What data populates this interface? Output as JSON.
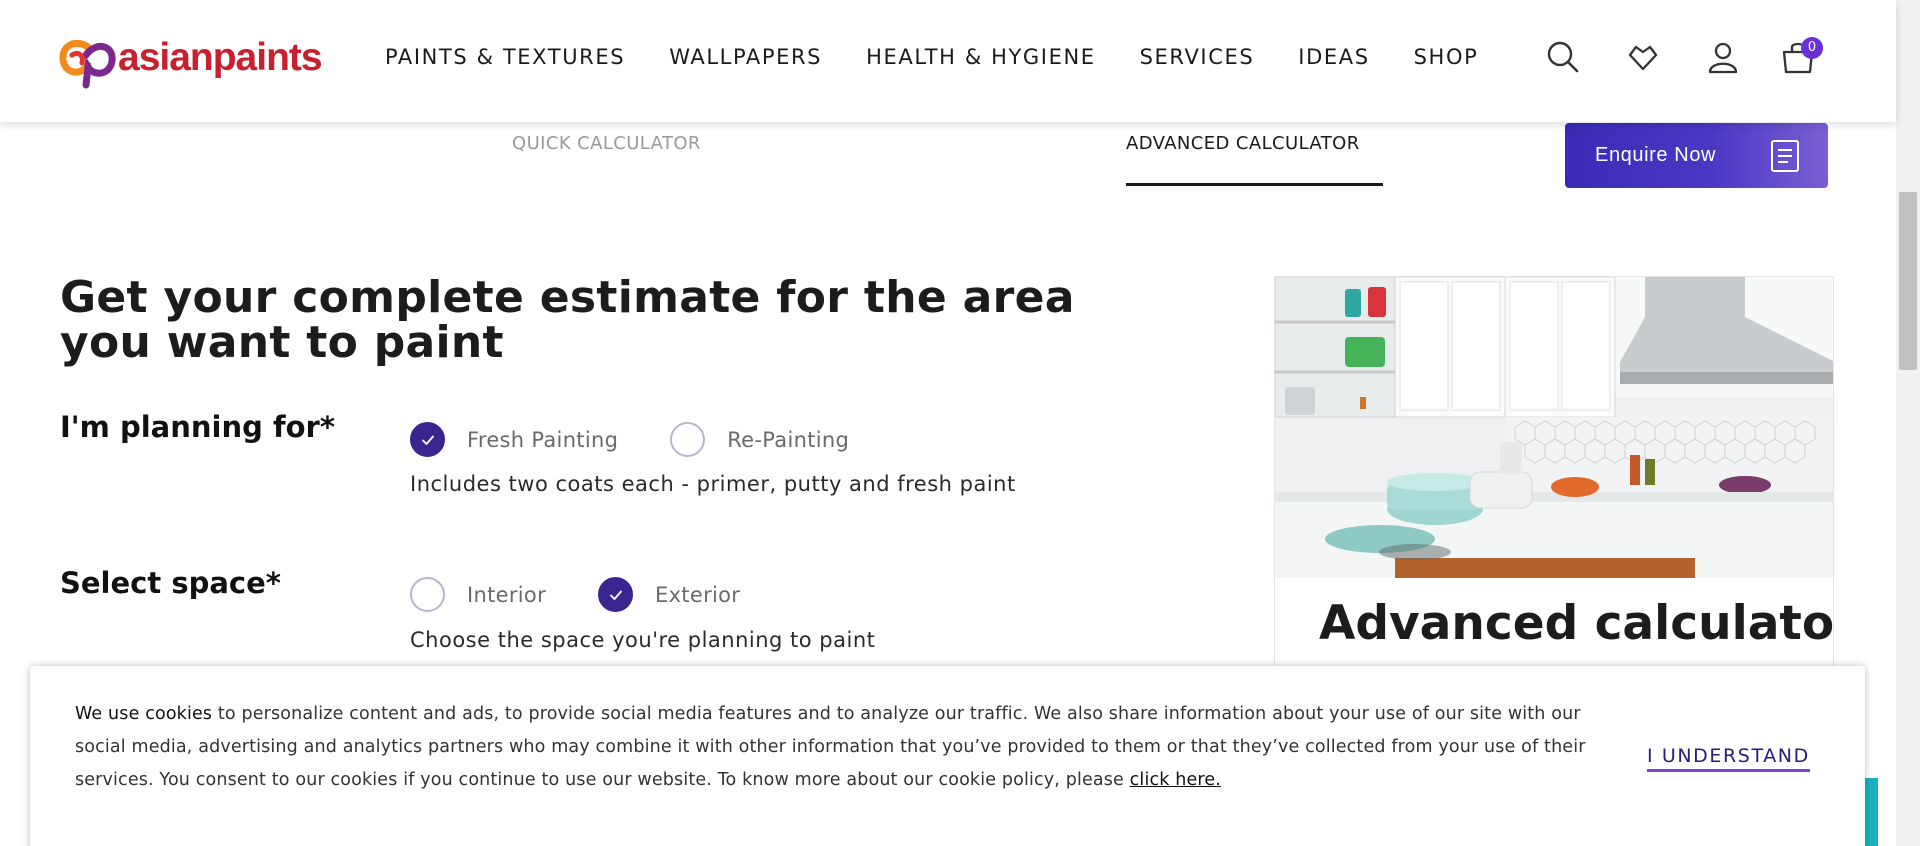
{
  "brand": {
    "name": "asianpaints"
  },
  "nav": {
    "items": [
      {
        "label": "PAINTS & TEXTURES"
      },
      {
        "label": "WALLPAPERS"
      },
      {
        "label": "HEALTH & HYGIENE"
      },
      {
        "label": "SERVICES"
      },
      {
        "label": "IDEAS"
      },
      {
        "label": "SHOP"
      }
    ],
    "icons": [
      "search-icon",
      "wishlist-heart-icon",
      "user-icon",
      "cart-icon"
    ],
    "cart_count": "0"
  },
  "tabs": {
    "quick": "QUICK CALCULATOR",
    "advanced": "ADVANCED CALCULATOR",
    "active": "advanced"
  },
  "enquire": {
    "label": "Enquire Now",
    "icon": "document-icon"
  },
  "form": {
    "title": "Get your complete estimate for the area you want to paint",
    "planning": {
      "label": "I'm planning for*",
      "options": [
        {
          "label": "Fresh Painting",
          "checked": true
        },
        {
          "label": "Re-Painting",
          "checked": false
        }
      ],
      "hint": "Includes two coats each - primer, putty and fresh paint"
    },
    "space": {
      "label": "Select space*",
      "options": [
        {
          "label": "Interior",
          "checked": false
        },
        {
          "label": "Exterior",
          "checked": true
        }
      ],
      "hint": "Choose the space you're planning to paint"
    }
  },
  "side_card": {
    "title": "Advanced calculator"
  },
  "cookie": {
    "lead": "We use cookies",
    "text": " to personalize content and ads, to provide social media features and to analyze our traffic. We also share information about your use of our site with our social media, advertising and analytics partners who may combine it with other information that you’ve provided to them or that they’ve collected from your use of their services. You consent to our cookies if you continue to use our website. To know more about our cookie policy, please ",
    "link": "click here.",
    "accept": "I UNDERSTAND"
  },
  "colors": {
    "brand_red": "#c8202f",
    "accent_purple": "#3a2590",
    "enquire_gradient_start": "#3a2bb6",
    "enquire_gradient_end": "#7a5fd3",
    "badge": "#6a2fd6"
  }
}
